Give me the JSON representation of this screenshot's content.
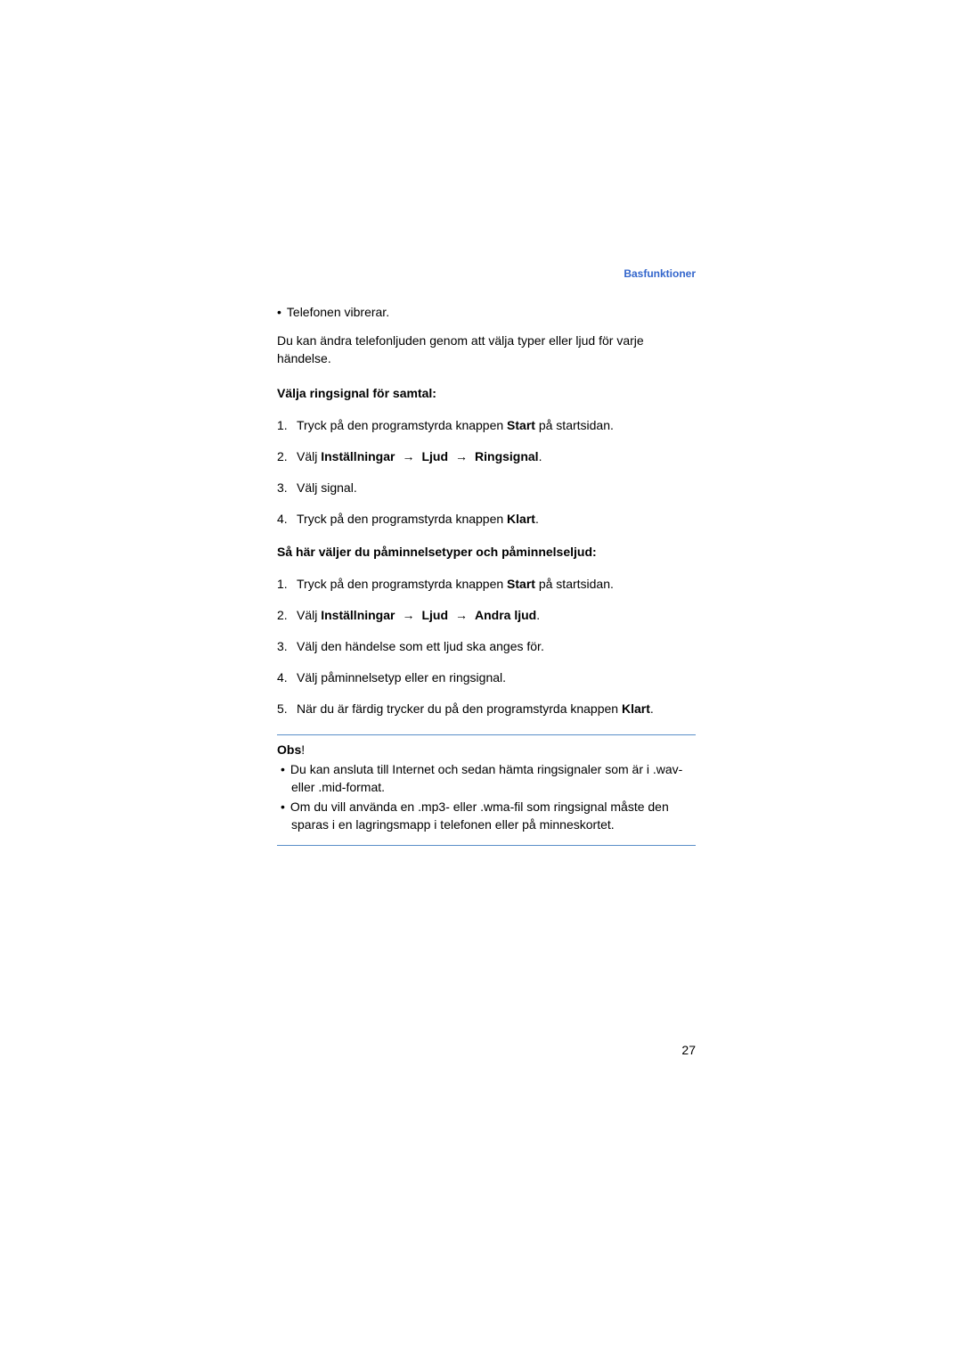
{
  "header": {
    "section_label": "Basfunktioner"
  },
  "bullet_intro": "Telefonen vibrerar.",
  "intro_para": "Du kan ändra telefonljuden genom att välja typer eller ljud för varje händelse.",
  "section1": {
    "title": "Välja ringsignal för samtal:",
    "items": [
      {
        "num": "1.",
        "pre": "Tryck på den programstyrda knappen ",
        "bold1": "Start",
        "post": " på startsidan."
      },
      {
        "num": "2.",
        "pre": "Välj ",
        "bold1": "Inställningar",
        "arrow1": "→",
        "bold2": "Ljud",
        "arrow2": "→",
        "bold3": "Ringsignal",
        "post": "."
      },
      {
        "num": "3.",
        "pre": "Välj signal.",
        "bold1": "",
        "post": ""
      },
      {
        "num": "4.",
        "pre": "Tryck på den programstyrda knappen ",
        "bold1": "Klart",
        "post": "."
      }
    ]
  },
  "section2": {
    "title": "Så här väljer du påminnelsetyper och påminnelseljud:",
    "items": [
      {
        "num": "1.",
        "pre": "Tryck på den programstyrda knappen ",
        "bold1": "Start",
        "post": " på startsidan."
      },
      {
        "num": "2.",
        "pre": "Välj ",
        "bold1": "Inställningar",
        "arrow1": "→",
        "bold2": "Ljud",
        "arrow2": "→",
        "bold3": "Andra ljud",
        "post": "."
      },
      {
        "num": "3.",
        "pre": "Välj den händelse som ett ljud ska anges för.",
        "bold1": "",
        "post": ""
      },
      {
        "num": "4.",
        "pre": "Välj påminnelsetyp eller en ringsignal.",
        "bold1": "",
        "post": ""
      },
      {
        "num": "5.",
        "pre": "När du är färdig trycker du på den programstyrda knappen ",
        "bold1": "Klart",
        "post": "."
      }
    ]
  },
  "note": {
    "title_bold": "Obs",
    "title_rest": "!",
    "items": [
      "Du kan ansluta till Internet och sedan hämta ringsignaler som är i .wav- eller .mid-format.",
      "Om du vill använda en .mp3- eller .wma-fil som ringsignal måste den sparas i en lagringsmapp i telefonen eller på minneskortet."
    ]
  },
  "page_number": "27"
}
